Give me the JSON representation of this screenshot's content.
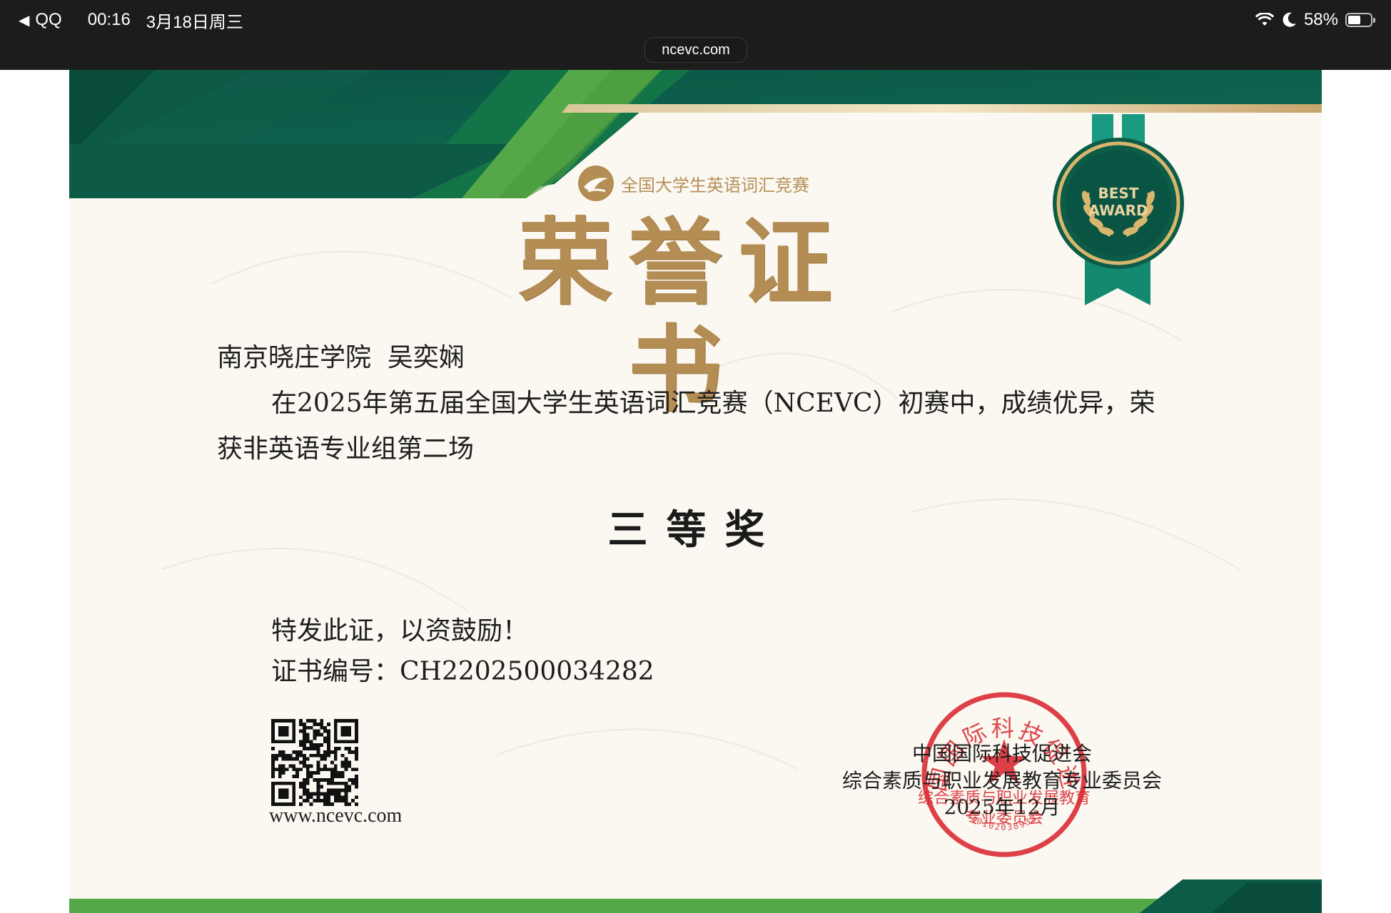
{
  "status_bar": {
    "back_app": "QQ",
    "time": "00:16",
    "date": "3月18日周三",
    "battery": "58%",
    "battery_level": 0.58
  },
  "browser": {
    "url": "ncevc.com"
  },
  "certificate": {
    "competition_logo_text": "全国大学生英语词汇竞赛",
    "title": "荣誉证书",
    "badge": {
      "line1": "BEST",
      "line2": "AWARD"
    },
    "recipient": "南京晓庄学院  吴奕娴",
    "body": "在2025年第五届全国大学生英语词汇竞赛（NCEVC）初赛中，成绩优异，荣获非英语专业组第二场",
    "award_level": "三等奖",
    "closing": "特发此证，以资鼓励！",
    "certificate_number": "证书编号：CH2202500034282",
    "website": "www.ncevc.com",
    "issuer": {
      "line1": "中国国际科技促进会",
      "line2": "综合素质与职业发展教育专业委员会",
      "date": "2025年12月"
    },
    "seal": {
      "top_arc": "中国国际科技促进会",
      "middle": "综合素质与职业发展教育",
      "bottom": "专业委员会",
      "code": "1101020389333"
    }
  },
  "colors": {
    "dark_green": "#0c5c48",
    "bright_green": "#55a848",
    "gold": "#b48d55",
    "seal_red": "#d8262e",
    "status_bg": "#1c1c1c"
  }
}
